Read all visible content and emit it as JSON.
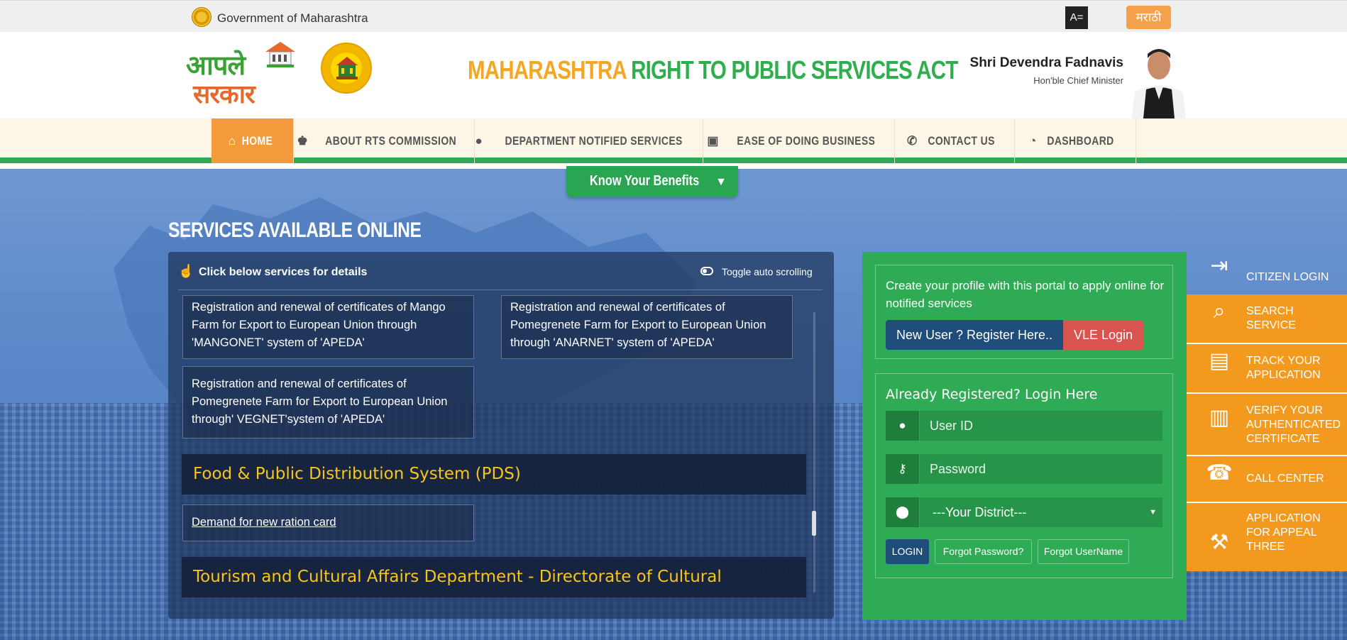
{
  "topbar": {
    "gov_label": "Government of Maharashtra",
    "font_toggle": "A=",
    "language_button": "मराठी"
  },
  "header": {
    "logo_line1": "आपले",
    "logo_line2": "सरकार",
    "act_title_part1": "MAHARASHTRA",
    "act_title_part2": "RIGHT TO PUBLIC SERVICES ACT",
    "cm_name": "Shri Devendra Fadnavis",
    "cm_title": "Hon'ble Chief Minister"
  },
  "nav": {
    "items": [
      {
        "icon": "home-icon",
        "glyph": "⌂",
        "label": "HOME"
      },
      {
        "icon": "person-icon",
        "glyph": "♚",
        "label": "ABOUT RTS COMMISSION"
      },
      {
        "icon": "user-icon",
        "glyph": "●",
        "label": "DEPARTMENT NOTIFIED SERVICES"
      },
      {
        "icon": "briefcase-icon",
        "glyph": "▣",
        "label": "EASE OF DOING BUSINESS"
      },
      {
        "icon": "phone-icon",
        "glyph": "✆",
        "label": "CONTACT US"
      },
      {
        "icon": "dashboard-icon",
        "glyph": "◔",
        "label": "DASHBOARD"
      }
    ],
    "active": "HOME"
  },
  "benefits_button": "Know Your Benefits",
  "services": {
    "title": "SERVICES AVAILABLE ONLINE",
    "header_text": "Click below services for details",
    "toggle_text": "Toggle auto scrolling",
    "cards": [
      "Registration and renewal of certificates of Mango Farm for Export to European Union through 'MANGONET' system of 'APEDA'",
      "Registration and renewal of certificates of Pomegrenete Farm for Export to European Union through 'ANARNET' system of 'APEDA'",
      "Registration and renewal of certificates of Pomegrenete Farm for Export to European Union through' VEGNET'system of 'APEDA'"
    ],
    "dept1": "Food & Public Distribution System (PDS)",
    "ration_card_link": "Demand for new ration card",
    "dept2": "Tourism and Cultural Affairs Department - Directorate of Cultural"
  },
  "register": {
    "text": "Create your profile with this portal to apply online for notified services",
    "register_button": "New User ? Register Here..",
    "vle_button": "VLE Login"
  },
  "login": {
    "title": "Already Registered? Login Here",
    "userid_placeholder": "User ID",
    "password_placeholder": "Password",
    "district_selected": "---Your District---",
    "login_button": "LOGIN",
    "forgot_password": "Forgot Password?",
    "forgot_username": "Forgot UserName"
  },
  "quick_links": [
    {
      "icon": "login-icon",
      "glyph": "⇥",
      "label": "CITIZEN LOGIN"
    },
    {
      "icon": "search-icon",
      "glyph": "⌕",
      "label": "SEARCH SERVICE"
    },
    {
      "icon": "document-icon",
      "glyph": "▤",
      "label": "TRACK YOUR APPLICATION"
    },
    {
      "icon": "barcode-icon",
      "glyph": "▥",
      "label": "VERIFY YOUR AUTHENTICATED CERTIFICATE"
    },
    {
      "icon": "telephone-icon",
      "glyph": "☎",
      "label": "CALL CENTER"
    },
    {
      "icon": "gavel-icon",
      "glyph": "⚒",
      "label": "APPLICATION FOR APPEAL THREE"
    }
  ],
  "colors": {
    "nav_active": "#f39a3d",
    "green": "#2fab55",
    "orange": "#f39a1e",
    "dept_heading": "#f7c518"
  }
}
